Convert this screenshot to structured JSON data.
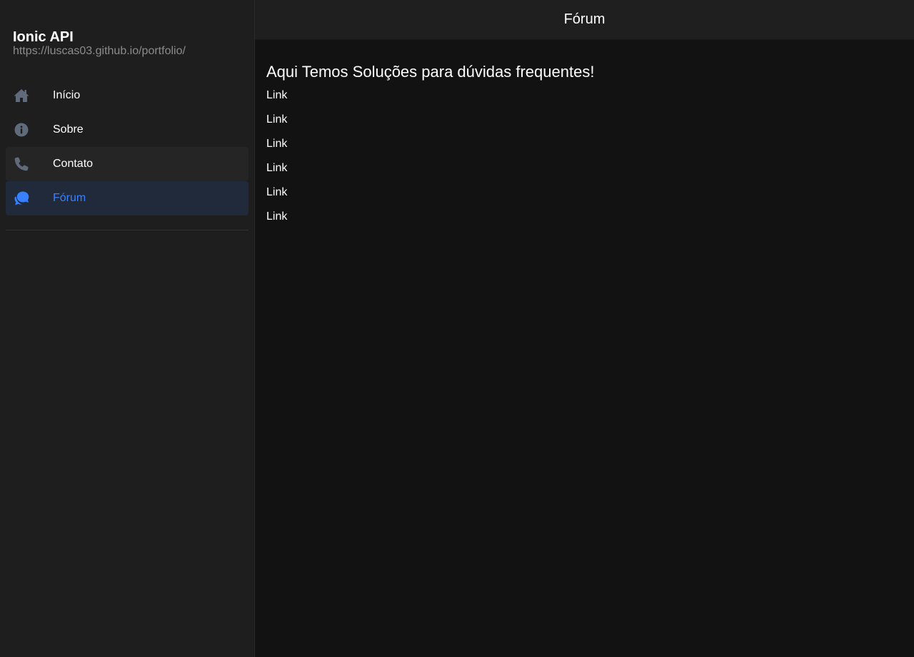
{
  "sidebar": {
    "title": "Ionic API",
    "subtitle": "https://luscas03.github.io/portfolio/",
    "items": [
      {
        "label": "Início",
        "icon": "home-icon",
        "state": "normal"
      },
      {
        "label": "Sobre",
        "icon": "info-icon",
        "state": "normal"
      },
      {
        "label": "Contato",
        "icon": "phone-icon",
        "state": "hover"
      },
      {
        "label": "Fórum",
        "icon": "chatbubbles-icon",
        "state": "active"
      }
    ]
  },
  "header": {
    "title": "Fórum"
  },
  "main": {
    "heading": "Aqui Temos Soluções para dúvidas frequentes!",
    "links": [
      "Link",
      "Link",
      "Link",
      "Link",
      "Link",
      "Link"
    ]
  },
  "colors": {
    "accent": "#3880ff",
    "icon_muted": "#5f6b7a",
    "background": "#121212",
    "sidebar_background": "#1e1e1e"
  }
}
